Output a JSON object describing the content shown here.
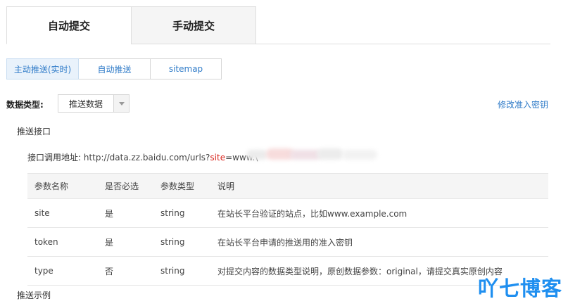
{
  "top_tabs": {
    "auto": "自动提交",
    "manual": "手动提交"
  },
  "sub_tabs": [
    "主动推送(实时)",
    "自动推送",
    "sitemap"
  ],
  "data_type": {
    "label": "数据类型:",
    "selected": "推送数据",
    "modify_link": "修改准入密钥"
  },
  "interface": {
    "title": "推送接口",
    "endpoint_label": "接口调用地址:",
    "endpoint_prefix": "http://data.zz.baidu.com/urls?",
    "endpoint_site": "site",
    "endpoint_suffix": "=www.\\"
  },
  "table": {
    "headers": [
      "参数名称",
      "是否必选",
      "参数类型",
      "说明"
    ],
    "rows": [
      {
        "name": "site",
        "required": "是",
        "type": "string",
        "desc": "在站长平台验证的站点，比如www.example.com"
      },
      {
        "name": "token",
        "required": "是",
        "type": "string",
        "desc": "在站长平台申请的推送用的准入密钥"
      },
      {
        "name": "type",
        "required": "否",
        "type": "string",
        "desc": "对提交内容的数据类型说明，原创数据参数：original，请提交真实原创内容"
      }
    ]
  },
  "example": {
    "title": "推送示例"
  },
  "watermark": "吖七博客",
  "colors": {
    "link": "#2f7bc8",
    "highlight": "#d9251d",
    "watermark": "#1f8ff0"
  }
}
